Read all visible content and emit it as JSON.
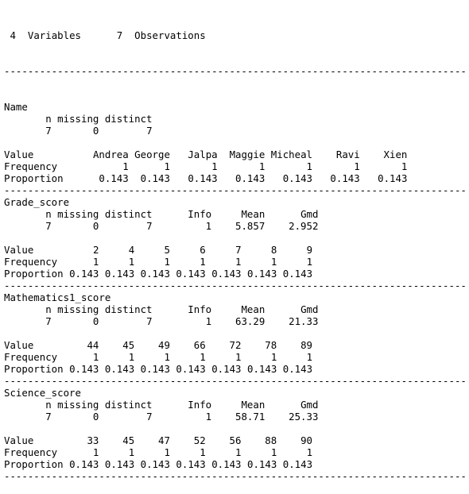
{
  "header": {
    "variables_count": "4",
    "variables_label": "Variables",
    "observations_count": "7",
    "observations_label": "Observations"
  },
  "rule_length": 78,
  "variables": [
    {
      "name": "Name",
      "stats_headers": [
        "n",
        "missing",
        "distinct"
      ],
      "stats_values": [
        "7",
        "0",
        "7"
      ],
      "value_label": "Value",
      "frequency_label": "Frequency",
      "proportion_label": "Proportion",
      "values": [
        "Andrea",
        "George",
        "Jalpa",
        "Maggie",
        "Micheal",
        "Ravi",
        "Xien"
      ],
      "frequencies": [
        "1",
        "1",
        "1",
        "1",
        "1",
        "1",
        "1"
      ],
      "proportions": [
        "0.143",
        "0.143",
        "0.143",
        "0.143",
        "0.143",
        "0.143",
        "0.143"
      ]
    },
    {
      "name": "Grade_score",
      "stats_headers": [
        "n",
        "missing",
        "distinct",
        "Info",
        "Mean",
        "Gmd"
      ],
      "stats_values": [
        "7",
        "0",
        "7",
        "1",
        "5.857",
        "2.952"
      ],
      "value_label": "Value",
      "frequency_label": "Frequency",
      "proportion_label": "Proportion",
      "values": [
        "2",
        "4",
        "5",
        "6",
        "7",
        "8",
        "9"
      ],
      "frequencies": [
        "1",
        "1",
        "1",
        "1",
        "1",
        "1",
        "1"
      ],
      "proportions": [
        "0.143",
        "0.143",
        "0.143",
        "0.143",
        "0.143",
        "0.143",
        "0.143"
      ]
    },
    {
      "name": "Mathematics1_score",
      "stats_headers": [
        "n",
        "missing",
        "distinct",
        "Info",
        "Mean",
        "Gmd"
      ],
      "stats_values": [
        "7",
        "0",
        "7",
        "1",
        "63.29",
        "21.33"
      ],
      "value_label": "Value",
      "frequency_label": "Frequency",
      "proportion_label": "Proportion",
      "values": [
        "44",
        "45",
        "49",
        "66",
        "72",
        "78",
        "89"
      ],
      "frequencies": [
        "1",
        "1",
        "1",
        "1",
        "1",
        "1",
        "1"
      ],
      "proportions": [
        "0.143",
        "0.143",
        "0.143",
        "0.143",
        "0.143",
        "0.143",
        "0.143"
      ]
    },
    {
      "name": "Science_score",
      "stats_headers": [
        "n",
        "missing",
        "distinct",
        "Info",
        "Mean",
        "Gmd"
      ],
      "stats_values": [
        "7",
        "0",
        "7",
        "1",
        "58.71",
        "25.33"
      ],
      "value_label": "Value",
      "frequency_label": "Frequency",
      "proportion_label": "Proportion",
      "values": [
        "33",
        "45",
        "47",
        "52",
        "56",
        "88",
        "90"
      ],
      "frequencies": [
        "1",
        "1",
        "1",
        "1",
        "1",
        "1",
        "1"
      ],
      "proportions": [
        "0.143",
        "0.143",
        "0.143",
        "0.143",
        "0.143",
        "0.143",
        "0.143"
      ]
    }
  ]
}
